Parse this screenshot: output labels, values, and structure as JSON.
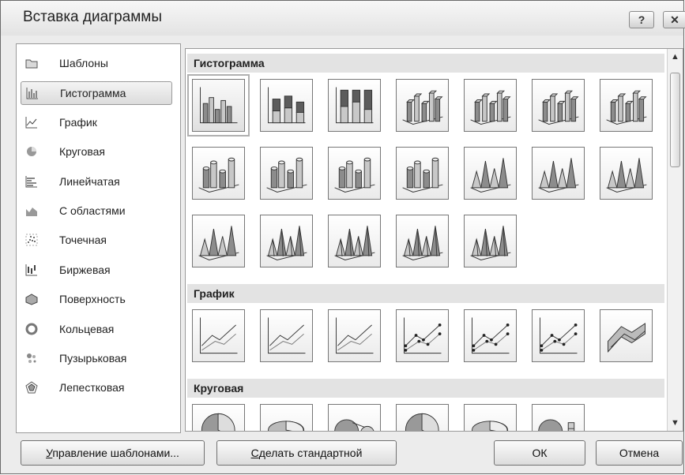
{
  "window": {
    "title": "Вставка диаграммы",
    "help_label": "?",
    "close_label": "x"
  },
  "categories": [
    {
      "label": "Шаблоны",
      "icon": "folder-icon",
      "selected": false
    },
    {
      "label": "Гистограмма",
      "icon": "column-chart-icon",
      "selected": true
    },
    {
      "label": "График",
      "icon": "line-chart-icon",
      "selected": false
    },
    {
      "label": "Круговая",
      "icon": "pie-chart-icon",
      "selected": false
    },
    {
      "label": "Линейчатая",
      "icon": "bar-chart-icon",
      "selected": false
    },
    {
      "label": "С областями",
      "icon": "area-chart-icon",
      "selected": false
    },
    {
      "label": "Точечная",
      "icon": "scatter-chart-icon",
      "selected": false
    },
    {
      "label": "Биржевая",
      "icon": "stock-chart-icon",
      "selected": false
    },
    {
      "label": "Поверхность",
      "icon": "surface-chart-icon",
      "selected": false
    },
    {
      "label": "Кольцевая",
      "icon": "doughnut-chart-icon",
      "selected": false
    },
    {
      "label": "Пузырьковая",
      "icon": "bubble-chart-icon",
      "selected": false
    },
    {
      "label": "Лепестковая",
      "icon": "radar-chart-icon",
      "selected": false
    }
  ],
  "sections": [
    {
      "title": "Гистограмма",
      "rows": [
        7,
        7,
        5
      ],
      "thumbnails": [
        "clustered-column",
        "stacked-column",
        "percent-stacked-column",
        "3d-clustered-column",
        "3d-stacked-column",
        "3d-percent-stacked-column",
        "3d-column",
        "clustered-cylinder",
        "stacked-cylinder",
        "percent-stacked-cylinder",
        "3d-cylinder",
        "clustered-cone",
        "stacked-cone",
        "percent-stacked-cone",
        "3d-cone",
        "clustered-pyramid",
        "stacked-pyramid",
        "percent-stacked-pyramid",
        "3d-pyramid"
      ]
    },
    {
      "title": "График",
      "rows": [
        7
      ],
      "thumbnails": [
        "line",
        "stacked-line",
        "percent-stacked-line",
        "line-with-markers",
        "stacked-line-with-markers",
        "percent-stacked-line-with-markers",
        "3d-line"
      ]
    },
    {
      "title": "Круговая",
      "rows": [
        6
      ],
      "thumbnails": [
        "pie",
        "3d-pie",
        "pie-of-pie",
        "exploded-pie",
        "3d-exploded-pie",
        "bar-of-pie"
      ]
    }
  ],
  "buttons": {
    "manage_templates_pre": "",
    "manage_templates_u": "У",
    "manage_templates_post": "правление шаблонами...",
    "set_default_pre": "",
    "set_default_u": "С",
    "set_default_post": "делать стандартной",
    "ok": "ОК",
    "cancel": "Отмена"
  },
  "colors": {
    "dialog_bg": "#ececec",
    "section_header": "#e3e3e3",
    "selection": "#dcdcdc"
  }
}
